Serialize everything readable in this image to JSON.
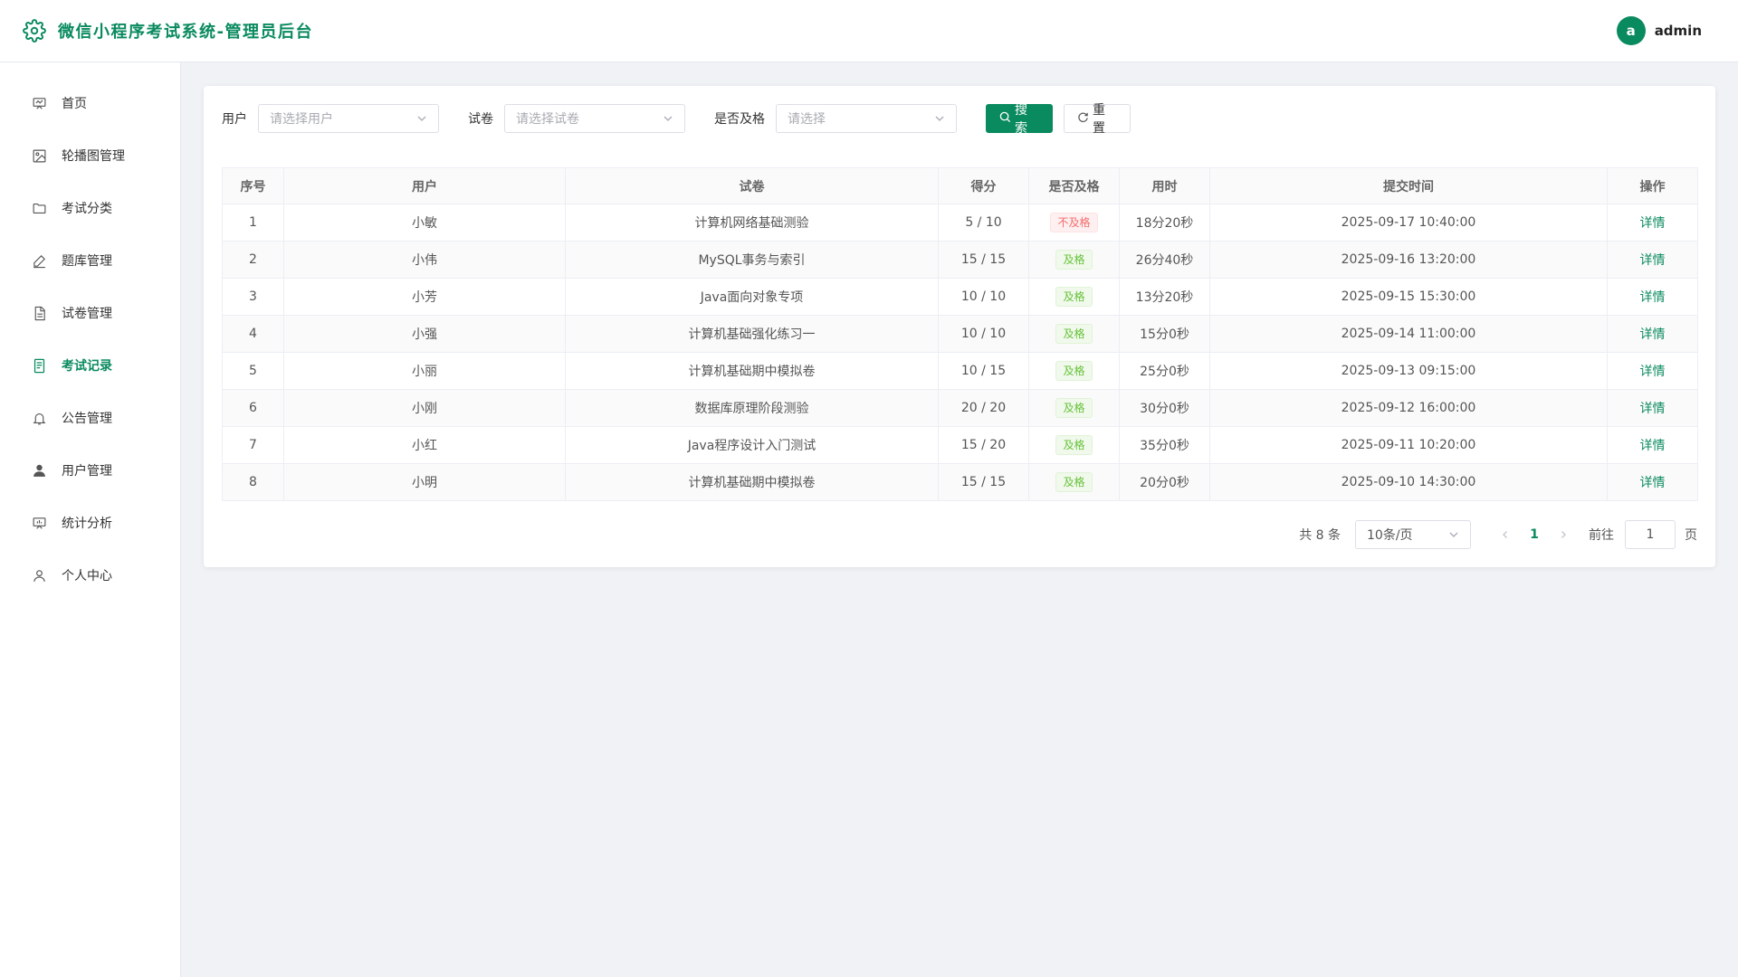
{
  "app": {
    "title": "微信小程序考试系统-管理员后台",
    "user": {
      "avatar_letter": "a",
      "name": "admin"
    },
    "accent_color": "#0a8a5f"
  },
  "sidebar": {
    "items": [
      {
        "label": "首页",
        "icon": "presentation-icon",
        "active": false
      },
      {
        "label": "轮播图管理",
        "icon": "image-icon",
        "active": false
      },
      {
        "label": "考试分类",
        "icon": "folder-icon",
        "active": false
      },
      {
        "label": "题库管理",
        "icon": "edit-pen-icon",
        "active": false
      },
      {
        "label": "试卷管理",
        "icon": "document-icon",
        "active": false
      },
      {
        "label": "考试记录",
        "icon": "record-document-icon",
        "active": true
      },
      {
        "label": "公告管理",
        "icon": "bell-icon",
        "active": false
      },
      {
        "label": "用户管理",
        "icon": "user-filled-icon",
        "active": false
      },
      {
        "label": "统计分析",
        "icon": "chart-board-icon",
        "active": false
      },
      {
        "label": "个人中心",
        "icon": "user-outline-icon",
        "active": false
      }
    ]
  },
  "filters": {
    "user": {
      "label": "用户",
      "placeholder": "请选择用户"
    },
    "paper": {
      "label": "试卷",
      "placeholder": "请选择试卷"
    },
    "pass": {
      "label": "是否及格",
      "placeholder": "请选择"
    },
    "search_label": "搜索",
    "reset_label": "重置"
  },
  "table": {
    "headers": [
      "序号",
      "用户",
      "试卷",
      "得分",
      "是否及格",
      "用时",
      "提交时间",
      "操作"
    ],
    "rows": [
      {
        "no": "1",
        "user": "小敏",
        "paper": "计算机网络基础测验",
        "score": "5 / 10",
        "pass": "不及格",
        "passed": false,
        "duration": "18分20秒",
        "time": "2025-09-17 10:40:00",
        "action": "详情"
      },
      {
        "no": "2",
        "user": "小伟",
        "paper": "MySQL事务与索引",
        "score": "15 / 15",
        "pass": "及格",
        "passed": true,
        "duration": "26分40秒",
        "time": "2025-09-16 13:20:00",
        "action": "详情"
      },
      {
        "no": "3",
        "user": "小芳",
        "paper": "Java面向对象专项",
        "score": "10 / 10",
        "pass": "及格",
        "passed": true,
        "duration": "13分20秒",
        "time": "2025-09-15 15:30:00",
        "action": "详情"
      },
      {
        "no": "4",
        "user": "小强",
        "paper": "计算机基础强化练习一",
        "score": "10 / 10",
        "pass": "及格",
        "passed": true,
        "duration": "15分0秒",
        "time": "2025-09-14 11:00:00",
        "action": "详情"
      },
      {
        "no": "5",
        "user": "小丽",
        "paper": "计算机基础期中模拟卷",
        "score": "10 / 15",
        "pass": "及格",
        "passed": true,
        "duration": "25分0秒",
        "time": "2025-09-13 09:15:00",
        "action": "详情"
      },
      {
        "no": "6",
        "user": "小刚",
        "paper": "数据库原理阶段测验",
        "score": "20 / 20",
        "pass": "及格",
        "passed": true,
        "duration": "30分0秒",
        "time": "2025-09-12 16:00:00",
        "action": "详情"
      },
      {
        "no": "7",
        "user": "小红",
        "paper": "Java程序设计入门测试",
        "score": "15 / 20",
        "pass": "及格",
        "passed": true,
        "duration": "35分0秒",
        "time": "2025-09-11 10:20:00",
        "action": "详情"
      },
      {
        "no": "8",
        "user": "小明",
        "paper": "计算机基础期中模拟卷",
        "score": "15 / 15",
        "pass": "及格",
        "passed": true,
        "duration": "20分0秒",
        "time": "2025-09-10 14:30:00",
        "action": "详情"
      }
    ]
  },
  "pagination": {
    "total": "共 8 条",
    "page_size": "10条/页",
    "current_page": "1",
    "goto_label": "前往",
    "goto_value": "1",
    "page_suffix": "页"
  }
}
